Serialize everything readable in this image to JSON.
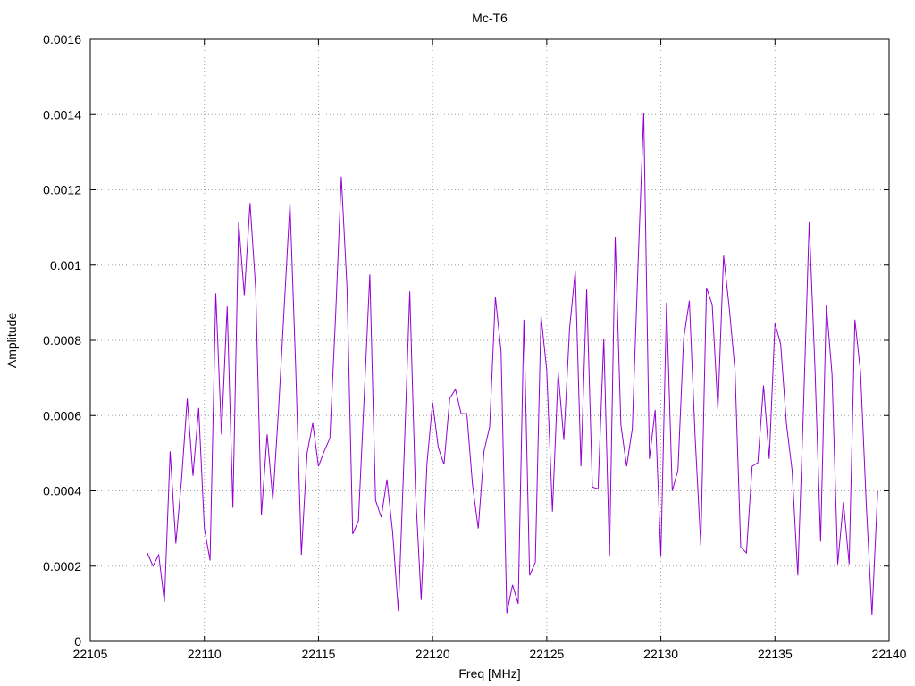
{
  "chart_data": {
    "type": "line",
    "title": "Mc-T6",
    "xlabel": "Freq [MHz]",
    "ylabel": "Amplitude",
    "xlim": [
      22105,
      22140
    ],
    "ylim": [
      0,
      0.0016
    ],
    "xticks": [
      "22105",
      "22110",
      "22115",
      "22120",
      "22125",
      "22130",
      "22135",
      "22140"
    ],
    "yticks": [
      "0",
      "0.0002",
      "0.0004",
      "0.0006",
      "0.0008",
      "0.001",
      "0.0012",
      "0.0014",
      "0.0016"
    ],
    "grid": true,
    "line_color": "#9400d3",
    "series": [
      {
        "x": [
          22107.5,
          22107.75,
          22108.0,
          22108.25,
          22108.5,
          22108.75,
          22109.0,
          22109.25,
          22109.5,
          22109.75,
          22110.0,
          22110.25,
          22110.5,
          22110.75,
          22111.0,
          22111.25,
          22111.5,
          22111.75,
          22112.0,
          22112.25,
          22112.5,
          22112.75,
          22113.0,
          22113.25,
          22113.5,
          22113.75,
          22114.0,
          22114.25,
          22114.5,
          22114.75,
          22115.0,
          22115.25,
          22115.5,
          22115.75,
          22116.0,
          22116.25,
          22116.5,
          22116.75,
          22117.0,
          22117.25,
          22117.5,
          22117.75,
          22118.0,
          22118.25,
          22118.5,
          22118.75,
          22119.0,
          22119.25,
          22119.5,
          22119.75,
          22120.0,
          22120.25,
          22120.5,
          22120.75,
          22121.0,
          22121.25,
          22121.5,
          22121.75,
          22122.0,
          22122.25,
          22122.5,
          22122.75,
          22123.0,
          22123.25,
          22123.5,
          22123.75,
          22124.0,
          22124.25,
          22124.5,
          22124.75,
          22125.0,
          22125.25,
          22125.5,
          22125.75,
          22126.0,
          22126.25,
          22126.5,
          22126.75,
          22127.0,
          22127.25,
          22127.5,
          22127.75,
          22128.0,
          22128.25,
          22128.5,
          22128.75,
          22129.0,
          22129.25,
          22129.5,
          22129.75,
          22130.0,
          22130.25,
          22130.5,
          22130.75,
          22131.0,
          22131.25,
          22131.5,
          22131.75,
          22132.0,
          22132.25,
          22132.5,
          22132.75,
          22133.0,
          22133.25,
          22133.5,
          22133.75,
          22134.0,
          22134.25,
          22134.5,
          22134.75,
          22135.0,
          22135.25,
          22135.5,
          22135.75,
          22136.0,
          22136.25,
          22136.5,
          22136.75,
          22137.0,
          22137.25,
          22137.5,
          22137.75,
          22138.0,
          22138.25,
          22138.5,
          22138.75,
          22139.0,
          22139.25,
          22139.5
        ],
        "y": [
          0.000235,
          0.0002,
          0.00023,
          0.000105,
          0.000505,
          0.00026,
          0.00043,
          0.000645,
          0.00044,
          0.00062,
          0.0003,
          0.000215,
          0.000925,
          0.00055,
          0.00089,
          0.000355,
          0.001115,
          0.00092,
          0.001165,
          0.000935,
          0.000335,
          0.00055,
          0.000375,
          0.000615,
          0.00089,
          0.001165,
          0.00073,
          0.00023,
          0.0005,
          0.00058,
          0.000465,
          0.000505,
          0.00054,
          0.000865,
          0.001235,
          0.00094,
          0.000285,
          0.00032,
          0.000645,
          0.000975,
          0.000375,
          0.00033,
          0.00043,
          0.00029,
          8e-05,
          0.00049,
          0.00093,
          0.0004,
          0.00011,
          0.00047,
          0.000635,
          0.000515,
          0.00047,
          0.000645,
          0.00067,
          0.000605,
          0.000605,
          0.000415,
          0.0003,
          0.000505,
          0.00057,
          0.000915,
          0.00077,
          7.5e-05,
          0.00015,
          0.0001,
          0.000855,
          0.000175,
          0.00021,
          0.000865,
          0.00072,
          0.000345,
          0.000715,
          0.000535,
          0.00083,
          0.000985,
          0.000465,
          0.000935,
          0.00041,
          0.000405,
          0.000805,
          0.000225,
          0.001075,
          0.000575,
          0.000465,
          0.000565,
          0.001,
          0.001405,
          0.000485,
          0.000615,
          0.000225,
          0.0009,
          0.0004,
          0.000455,
          0.000805,
          0.000905,
          0.000545,
          0.000255,
          0.00094,
          0.000895,
          0.000615,
          0.001025,
          0.000885,
          0.00072,
          0.00025,
          0.000235,
          0.000465,
          0.000475,
          0.00068,
          0.000485,
          0.000845,
          0.00079,
          0.00058,
          0.000455,
          0.000175,
          0.00062,
          0.001115,
          0.00073,
          0.000265,
          0.000895,
          0.00071,
          0.000205,
          0.00037,
          0.000205,
          0.000855,
          0.000715,
          0.000365,
          7e-05,
          0.0004
        ]
      }
    ]
  }
}
